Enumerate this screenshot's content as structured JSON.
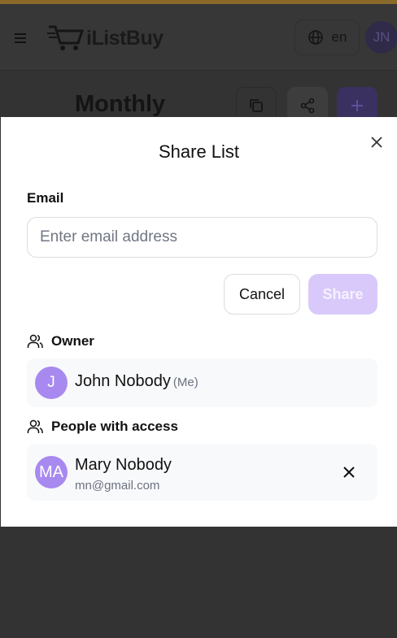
{
  "header": {
    "logo_text": "iListBuy",
    "language": "en",
    "user_initials": "JN"
  },
  "page": {
    "title": "Monthly"
  },
  "modal": {
    "title": "Share List",
    "email_label": "Email",
    "email_placeholder": "Enter email address",
    "email_value": "",
    "cancel_label": "Cancel",
    "share_label": "Share",
    "owner_heading": "Owner",
    "owner": {
      "initials": "J",
      "name": "John Nobody",
      "tag": "(Me)"
    },
    "people_heading": "People with access",
    "people": [
      {
        "initials": "MA",
        "name": "Mary Nobody",
        "email": "mn@gmail.com"
      }
    ]
  },
  "colors": {
    "accent": "#a889f0",
    "share_disabled": "#d8c9fa",
    "overlay": "#333333"
  },
  "icons": [
    "menu-icon",
    "cart-logo-icon",
    "globe-icon",
    "copy-icon",
    "share-icon",
    "plus-icon",
    "close-icon",
    "users-icon",
    "remove-icon"
  ]
}
